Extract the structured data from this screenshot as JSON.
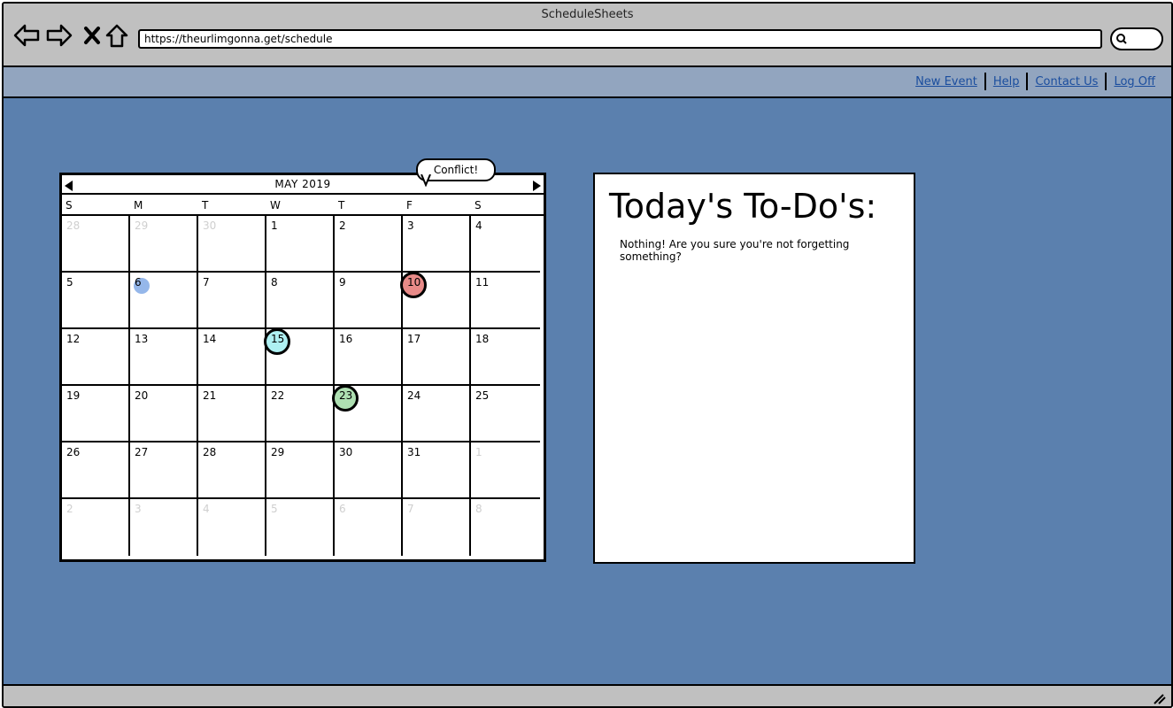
{
  "window": {
    "title": "ScheduleSheets"
  },
  "address_bar": {
    "url": "https://theurlimgonna.get/schedule"
  },
  "nav": {
    "links": [
      "New Event",
      "Help",
      "Contact Us",
      "Log Off"
    ]
  },
  "calendar": {
    "month_label": "MAY 2019",
    "weekdays": [
      "S",
      "M",
      "T",
      "W",
      "T",
      "F",
      "S"
    ],
    "weeks": [
      [
        {
          "d": "28",
          "muted": true
        },
        {
          "d": "29",
          "muted": true
        },
        {
          "d": "30",
          "muted": true
        },
        {
          "d": "1"
        },
        {
          "d": "2"
        },
        {
          "d": "3"
        },
        {
          "d": "4"
        }
      ],
      [
        {
          "d": "5"
        },
        {
          "d": "6",
          "mark": "blue"
        },
        {
          "d": "7"
        },
        {
          "d": "8"
        },
        {
          "d": "9"
        },
        {
          "d": "10",
          "mark": "red"
        },
        {
          "d": "11"
        }
      ],
      [
        {
          "d": "12"
        },
        {
          "d": "13"
        },
        {
          "d": "14"
        },
        {
          "d": "15",
          "mark": "cyan"
        },
        {
          "d": "16"
        },
        {
          "d": "17"
        },
        {
          "d": "18"
        }
      ],
      [
        {
          "d": "19"
        },
        {
          "d": "20"
        },
        {
          "d": "21"
        },
        {
          "d": "22"
        },
        {
          "d": "23",
          "mark": "green"
        },
        {
          "d": "24"
        },
        {
          "d": "25"
        }
      ],
      [
        {
          "d": "26"
        },
        {
          "d": "27"
        },
        {
          "d": "28"
        },
        {
          "d": "29"
        },
        {
          "d": "30"
        },
        {
          "d": "31"
        },
        {
          "d": "1",
          "muted": true
        }
      ],
      [
        {
          "d": "2",
          "muted": true
        },
        {
          "d": "3",
          "muted": true
        },
        {
          "d": "4",
          "muted": true
        },
        {
          "d": "5",
          "muted": true
        },
        {
          "d": "6",
          "muted": true
        },
        {
          "d": "7",
          "muted": true
        },
        {
          "d": "8",
          "muted": true
        }
      ]
    ],
    "callout": "Conflict!",
    "mark_colors": {
      "red": "#e88a88",
      "cyan": "#aef0f2",
      "green": "#aee0b2",
      "blue": "#95b7ea"
    }
  },
  "todo": {
    "title": "Today's To-Do's:",
    "empty_message": "Nothing! Are you sure you're not forgetting something?"
  },
  "colors": {
    "content_bg": "#5b80ae",
    "nav_bg": "#92a5bf",
    "chrome_bg": "#c0c0c0",
    "link": "#1a4d9e"
  }
}
